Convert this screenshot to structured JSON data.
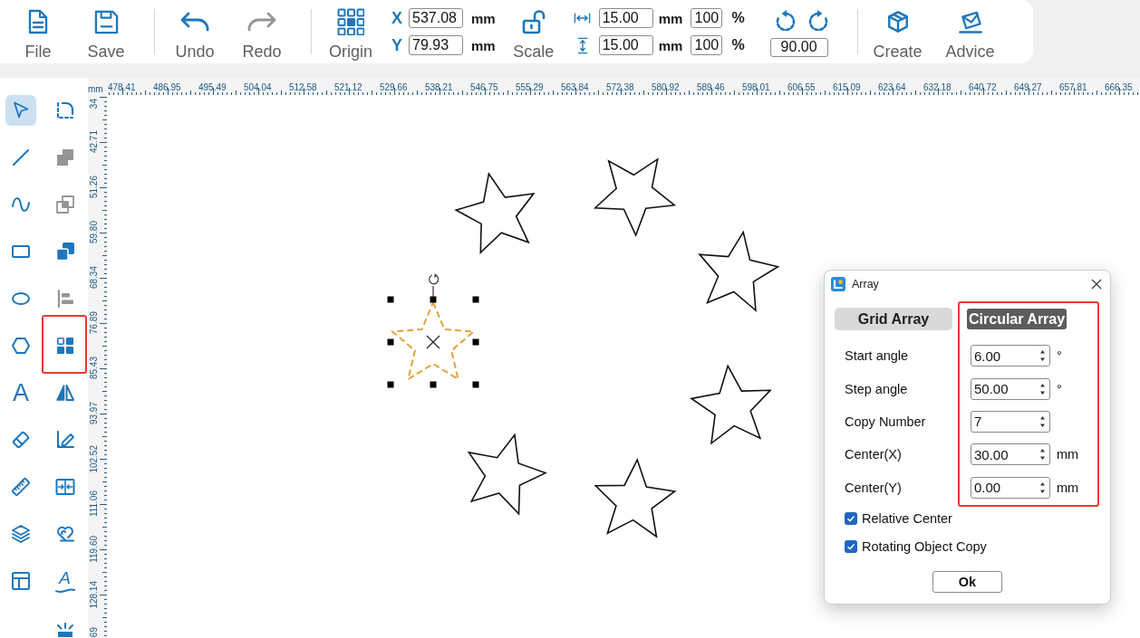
{
  "toolbar": {
    "file_buttons": [
      {
        "kind": "file",
        "label": "File"
      },
      {
        "kind": "save",
        "label": "Save"
      }
    ],
    "history_buttons": [
      {
        "kind": "undo",
        "label": "Undo",
        "disabled": false
      },
      {
        "kind": "redo",
        "label": "Redo",
        "disabled": true
      }
    ],
    "origin_button": {
      "label": "Origin"
    },
    "position_fields": [
      {
        "axis": "X",
        "value": "537.08",
        "unit": "mm"
      },
      {
        "axis": "Y",
        "value": "79.93",
        "unit": "mm"
      }
    ],
    "scale_button": {
      "label": "Scale",
      "locked": false
    },
    "size_fields": [
      {
        "kind": "width",
        "value": "15.00",
        "unit": "mm",
        "percent": "100",
        "percent_sign": "%"
      },
      {
        "kind": "height",
        "value": "15.00",
        "unit": "mm",
        "percent": "100",
        "percent_sign": "%"
      }
    ],
    "rotation_field": {
      "value": "90.00"
    },
    "action_buttons": [
      {
        "kind": "create",
        "label": "Create"
      },
      {
        "kind": "advice",
        "label": "Advice"
      }
    ]
  },
  "ruler": {
    "corner_unit": "mm",
    "top_labels": [
      "478.41",
      "486.95",
      "495.49",
      "504.04",
      "512.58",
      "521.12",
      "529.66",
      "538.21",
      "546.75",
      "555.29",
      "563.84",
      "572.38",
      "580.92",
      "589.46",
      "598.01",
      "606.55",
      "615.09",
      "623.64",
      "632.18",
      "640.72",
      "649.27",
      "657.81",
      "666.35"
    ],
    "left_labels": [
      "34",
      "42.71",
      "51.26",
      "59.80",
      "68.34",
      "76.89",
      "85.43",
      "93.97",
      "102.52",
      "111.06",
      "119.60",
      "128.14",
      "69"
    ]
  },
  "tool_columns": [
    [
      {
        "kind": "select",
        "selected": true,
        "disabled": false,
        "highlighted": false
      },
      {
        "kind": "line",
        "selected": false,
        "disabled": false,
        "highlighted": false
      },
      {
        "kind": "curve",
        "selected": false,
        "disabled": false,
        "highlighted": false
      },
      {
        "kind": "rectangle",
        "selected": false,
        "disabled": false,
        "highlighted": false
      },
      {
        "kind": "ellipse",
        "selected": false,
        "disabled": false,
        "highlighted": false
      },
      {
        "kind": "polygon",
        "selected": false,
        "disabled": false,
        "highlighted": false
      },
      {
        "kind": "text",
        "glyph": "A",
        "selected": false,
        "disabled": false,
        "highlighted": false
      },
      {
        "kind": "eraser",
        "selected": false,
        "disabled": false,
        "highlighted": false
      },
      {
        "kind": "ruler",
        "selected": false,
        "disabled": false,
        "highlighted": false
      },
      {
        "kind": "layers",
        "selected": false,
        "disabled": false,
        "highlighted": false
      },
      {
        "kind": "layout",
        "selected": false,
        "disabled": false,
        "highlighted": false
      }
    ],
    [
      {
        "kind": "frame",
        "selected": false,
        "disabled": false,
        "highlighted": false
      },
      {
        "kind": "union",
        "selected": false,
        "disabled": true,
        "highlighted": false
      },
      {
        "kind": "intersect",
        "selected": false,
        "disabled": true,
        "highlighted": false
      },
      {
        "kind": "combine",
        "selected": false,
        "disabled": false,
        "highlighted": false
      },
      {
        "kind": "align",
        "selected": false,
        "disabled": true,
        "highlighted": false
      },
      {
        "kind": "array",
        "selected": false,
        "disabled": false,
        "highlighted": true
      },
      {
        "kind": "mirror",
        "selected": false,
        "disabled": false,
        "highlighted": false
      },
      {
        "kind": "measure",
        "selected": false,
        "disabled": false,
        "highlighted": false
      },
      {
        "kind": "split",
        "selected": false,
        "disabled": false,
        "highlighted": false
      },
      {
        "kind": "weld",
        "selected": false,
        "disabled": false,
        "highlighted": false
      },
      {
        "kind": "curve_text",
        "glyph": "A",
        "selected": false,
        "disabled": false,
        "highlighted": false
      },
      {
        "kind": "burst",
        "selected": false,
        "disabled": false,
        "highlighted": false
      }
    ]
  ],
  "canvas": {
    "shapes": [
      {
        "kind": "star",
        "selected": true
      },
      {
        "kind": "star",
        "selected": false
      },
      {
        "kind": "star",
        "selected": false
      },
      {
        "kind": "star",
        "selected": false
      },
      {
        "kind": "star",
        "selected": false
      },
      {
        "kind": "star",
        "selected": false
      },
      {
        "kind": "star",
        "selected": false
      }
    ]
  },
  "dialog": {
    "title": "Array",
    "tabs": [
      {
        "label": "Grid Array",
        "selected": false
      },
      {
        "label": "Circular Array",
        "selected": true
      }
    ],
    "settings_highlighted": true,
    "fields": [
      {
        "label": "Start angle",
        "value": "6.00",
        "unit": "°"
      },
      {
        "label": "Step angle",
        "value": "50.00",
        "unit": "°"
      },
      {
        "label": "Copy Number",
        "value": "7"
      },
      {
        "label": "Center(X)",
        "value": "30.00",
        "unit": "mm"
      },
      {
        "label": "Center(Y)",
        "value": "0.00",
        "unit": "mm"
      }
    ],
    "checkboxes": [
      {
        "label": "Relative Center",
        "checked": true
      },
      {
        "label": "Rotating Object Copy",
        "checked": true
      }
    ],
    "ok_button": {
      "label": "Ok"
    }
  }
}
